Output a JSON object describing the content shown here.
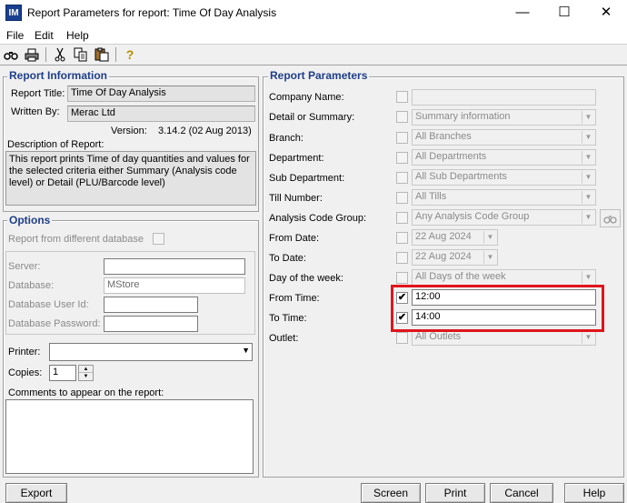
{
  "window": {
    "app_icon_text": "IM",
    "title": "Report Parameters for report: Time Of Day Analysis",
    "minimize": "—",
    "maximize": "☐",
    "close": "✕"
  },
  "menu": [
    "File",
    "Edit",
    "Help"
  ],
  "report_info": {
    "section_title": "Report Information",
    "report_title_label": "Report Title:",
    "report_title_value": "Time Of Day Analysis",
    "written_by_label": "Written By:",
    "written_by_value": "Merac Ltd",
    "version_label": "Version:",
    "version_value": "3.14.2 (02 Aug 2013)",
    "description_label": "Description of Report:",
    "description_value": "This report prints Time of day quantities and values for the selected criteria either Summary (Analysis code level) or Detail (PLU/Barcode level)"
  },
  "options": {
    "section_title": "Options",
    "diff_db_label": "Report from different database",
    "server_label": "Server:",
    "server_value": "",
    "database_label": "Database:",
    "database_value": "MStore",
    "db_user_label": "Database User Id:",
    "db_user_value": "",
    "db_pass_label": "Database Password:",
    "db_pass_value": "",
    "printer_label": "Printer:",
    "printer_value": "",
    "copies_label": "Copies:",
    "copies_value": "1",
    "comments_label": "Comments to appear on the report:",
    "comments_value": ""
  },
  "params": {
    "section_title": "Report Parameters",
    "company_name_label": "Company Name:",
    "company_name_value": "",
    "detail_summary_label": "Detail or Summary:",
    "detail_summary_value": "Summary information",
    "branch_label": "Branch:",
    "branch_value": "All Branches",
    "department_label": "Department:",
    "department_value": "All Departments",
    "sub_department_label": "Sub Department:",
    "sub_department_value": "All Sub Departments",
    "till_label": "Till Number:",
    "till_value": "All Tills",
    "analysis_label": "Analysis Code Group:",
    "analysis_value": "Any Analysis Code Group",
    "from_date_label": "From Date:",
    "from_date_value": "22 Aug 2024",
    "to_date_label": "To Date:",
    "to_date_value": "22 Aug 2024",
    "dow_label": "Day of the week:",
    "dow_value": "All Days of the week",
    "from_time_label": "From Time:",
    "from_time_value": "12:00",
    "to_time_label": "To Time:",
    "to_time_value": "14:00",
    "outlet_label": "Outlet:",
    "outlet_value": "All Outlets",
    "check_mark": "✔"
  },
  "buttons": {
    "export": "Export",
    "screen": "Screen",
    "print": "Print",
    "cancel": "Cancel",
    "help": "Help"
  },
  "colors": {
    "highlight": "#e0141c",
    "section_title": "#1e3e8a"
  },
  "icons": [
    "binoculars-icon",
    "printer-icon",
    "scissors-icon",
    "copy-icon",
    "paste-icon",
    "help-icon"
  ]
}
